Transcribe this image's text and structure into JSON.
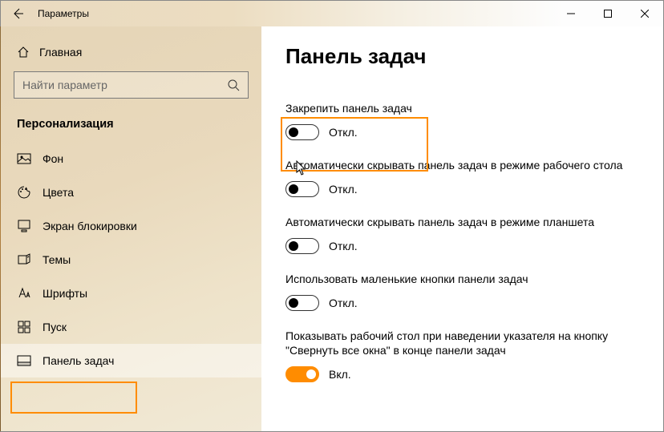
{
  "window": {
    "title": "Параметры"
  },
  "sidebar": {
    "home": "Главная",
    "search_placeholder": "Найти параметр",
    "section": "Персонализация",
    "items": [
      {
        "icon": "picture-icon",
        "label": "Фон"
      },
      {
        "icon": "palette-icon",
        "label": "Цвета"
      },
      {
        "icon": "lockscreen-icon",
        "label": "Экран блокировки"
      },
      {
        "icon": "themes-icon",
        "label": "Темы"
      },
      {
        "icon": "font-icon",
        "label": "Шрифты"
      },
      {
        "icon": "start-icon",
        "label": "Пуск"
      },
      {
        "icon": "taskbar-icon",
        "label": "Панель задач"
      }
    ]
  },
  "page": {
    "heading": "Панель задач",
    "settings": [
      {
        "label": "Закрепить панель задач",
        "on": false,
        "state": "Откл."
      },
      {
        "label": "Автоматически скрывать панель задач в режиме рабочего стола",
        "on": false,
        "state": "Откл."
      },
      {
        "label": "Автоматически скрывать панель задач в режиме планшета",
        "on": false,
        "state": "Откл."
      },
      {
        "label": "Использовать маленькие кнопки панели задач",
        "on": false,
        "state": "Откл."
      },
      {
        "label": "Показывать рабочий стол при наведении указателя на кнопку \"Свернуть все окна\" в конце панели задач",
        "on": true,
        "state": "Вкл."
      }
    ]
  }
}
